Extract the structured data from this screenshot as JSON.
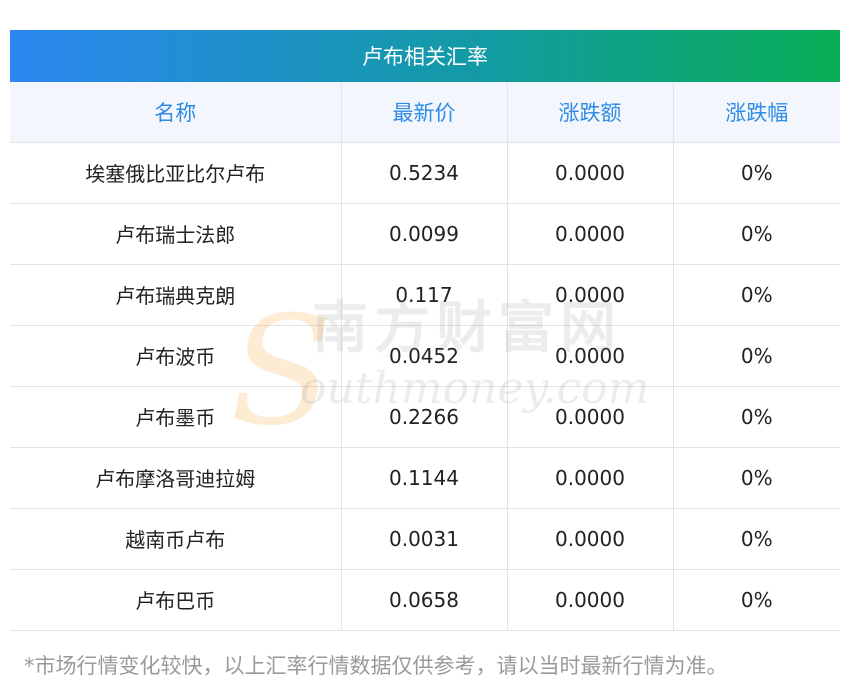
{
  "table": {
    "title": "卢布相关汇率",
    "headers": [
      "名称",
      "最新价",
      "涨跌额",
      "涨跌幅"
    ],
    "rows": [
      [
        "埃塞俄比亚比尔卢布",
        "0.5234",
        "0.0000",
        "0%"
      ],
      [
        "卢布瑞士法郎",
        "0.0099",
        "0.0000",
        "0%"
      ],
      [
        "卢布瑞典克朗",
        "0.117",
        "0.0000",
        "0%"
      ],
      [
        "卢布波币",
        "0.0452",
        "0.0000",
        "0%"
      ],
      [
        "卢布墨币",
        "0.2266",
        "0.0000",
        "0%"
      ],
      [
        "卢布摩洛哥迪拉姆",
        "0.1144",
        "0.0000",
        "0%"
      ],
      [
        "越南币卢布",
        "0.0031",
        "0.0000",
        "0%"
      ],
      [
        "卢布巴币",
        "0.0658",
        "0.0000",
        "0%"
      ]
    ]
  },
  "watermark": {
    "cn_text": "南方财富网",
    "en_text": "outhmoney.com",
    "logo_letter": "S"
  },
  "footnote": "*市场行情变化较快，以上汇率行情数据仅供参考，请以当时最新行情为准。"
}
